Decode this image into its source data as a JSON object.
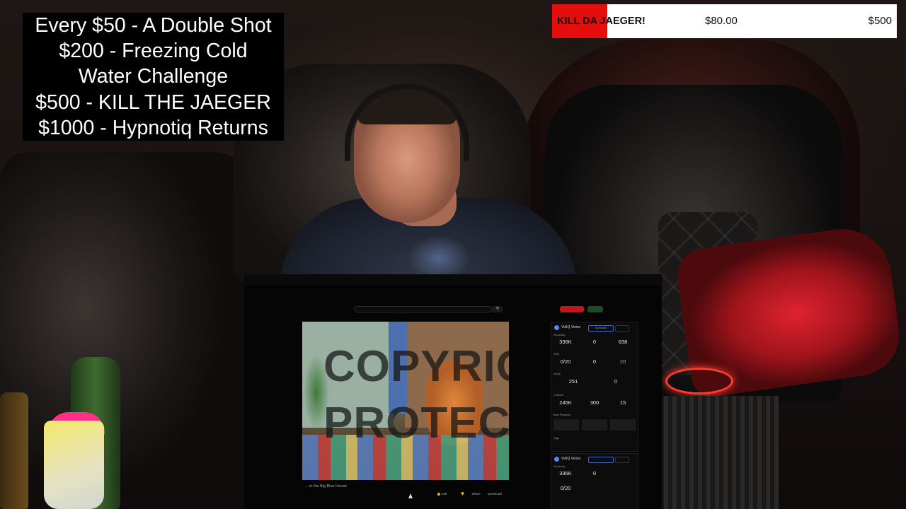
{
  "goals_overlay": {
    "lines": [
      "Every $50 - A Double Shot",
      "$200 - Freezing Cold",
      "Water Challenge",
      "$500 - KILL THE JAEGER",
      "$1000 - Hypnotiq Returns"
    ]
  },
  "goal_bar": {
    "label": "KILL DA JAEGER!",
    "current": "$80.00",
    "target": "$500",
    "progress_fraction": 0.16,
    "fill_color": "#e60d0d",
    "background_color": "#ffffff"
  },
  "screen_share": {
    "youtube": {
      "search_icon": "search-icon",
      "video": {
        "watermark_line1": "COPYRIG",
        "watermark_line2": "PROTECT",
        "title": "... in the Big Blue House"
      },
      "actions": {
        "like_count": "438",
        "dislike_icon": "thumbs-down-icon",
        "share": "Share",
        "download": "Download"
      }
    },
    "vidiq_panel": {
      "name": "VidIQ Vision",
      "tab_active": "Summary",
      "summary_label": "Summary",
      "views": "336K",
      "comments": "0",
      "likes": "638",
      "seo_label": "SEO",
      "tags_count": "0/20",
      "ranked_tags": "0",
      "seo_score": "20",
      "score_label": "Score",
      "likes_stat": "251",
      "dislikes_stat": "0",
      "channel_label": "Channel",
      "channel_views": "245K",
      "subscribers": "300",
      "videos": "15",
      "best_practices_label": "Best Practices",
      "tags_label": "Tags"
    },
    "vidiq_panel_2": {
      "name": "VidIQ Vision",
      "summary_label": "Summary",
      "views": "336K",
      "comments": "0",
      "tags_count": "0/20"
    }
  }
}
